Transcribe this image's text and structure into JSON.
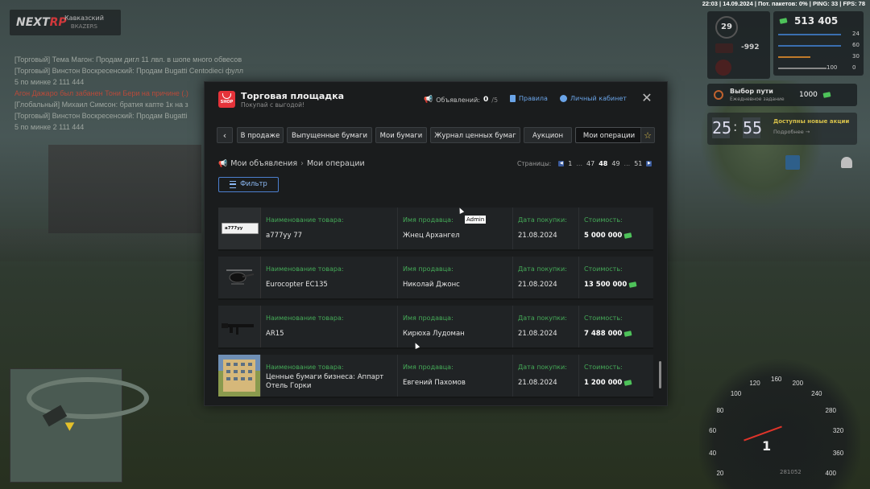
{
  "topbar": {
    "text": "22:03 | 14.09.2024 | Пот. пакетов: 0% | PING: 33 | FPS: 78"
  },
  "server": {
    "logo_a": "NEXT",
    "logo_b": "RP",
    "name": "Кавказский",
    "sub": "ВКАZERS"
  },
  "hud": {
    "money": "513 405",
    "level": "29",
    "balance": "-992",
    "stats": [
      "24",
      "60",
      "30",
      "100",
      "0"
    ],
    "quest_title": "Выбор пути",
    "quest_sub": "Ежедневное задание",
    "quest_reward": "1000",
    "time_h": "25",
    "time_m": "55",
    "available_actions": "Доступны новые акции",
    "details": "Подробнее →"
  },
  "chat": [
    {
      "text": "[Торговый] Тема Магон: Продам дигл 11 лвл. в шопе много обвесов",
      "cls": ""
    },
    {
      "text": "[Торговый] Винстон Воскресенский: Продам Bugatti Centodieci фулл",
      "cls": ""
    },
    {
      "text": "5 по минке 2 111 444",
      "cls": ""
    },
    {
      "text": "Агон Дажаро был забанен Тони Бери на причине (.)",
      "cls": "red"
    },
    {
      "text": "[Глобальный] Михаил Симсон: братия капте 1к на з",
      "cls": ""
    },
    {
      "text": "[Торговый] Винстон Воскресенский: Продам Bugatti",
      "cls": ""
    },
    {
      "text": "5 по минке 2 111 444",
      "cls": ""
    }
  ],
  "modal": {
    "title": "Торговая площадка",
    "subtitle": "Покупай с выгодой!",
    "shop_label": "SHOP",
    "ads_label": "Объявлений:",
    "ads_count": "0",
    "ads_max": "/5",
    "rules": "Правила",
    "cabinet": "Личный кабинет",
    "close": "✕"
  },
  "tabs": [
    {
      "label": "‹",
      "name": "tab-back"
    },
    {
      "label": "В продаже",
      "name": "tab-on-sale"
    },
    {
      "label": "Выпущенные бумаги",
      "name": "tab-issued-papers"
    },
    {
      "label": "Мои бумаги",
      "name": "tab-my-papers"
    },
    {
      "label": "Журнал ценных бумаг",
      "name": "tab-securities-journal"
    },
    {
      "label": "Аукцион",
      "name": "tab-auction"
    },
    {
      "label": "Мои операции",
      "name": "tab-my-operations"
    },
    {
      "label": "☆",
      "name": "tab-favorites"
    }
  ],
  "breadcrumb": {
    "parent": "Мои объявления",
    "current": "Мои операции"
  },
  "pagination": {
    "label": "Страницы:",
    "pages": [
      "1",
      "...",
      "47",
      "48",
      "49",
      "...",
      "51"
    ],
    "current": "48"
  },
  "filter_label": "Фильтр",
  "tooltip": "Admin",
  "columns": {
    "name": "Наименование товара:",
    "seller": "Имя продавца:",
    "date": "Дата покупки:",
    "price": "Стоимость:"
  },
  "operations": [
    {
      "item": "a777yy 77",
      "seller": "Жнец Архангел",
      "date": "21.08.2024",
      "price": "5 000 000",
      "thumb": "plate",
      "plate_text": "a777yy"
    },
    {
      "item": "Eurocopter EC135",
      "seller": "Николай Джонс",
      "date": "21.08.2024",
      "price": "13 500 000",
      "thumb": "heli"
    },
    {
      "item": "AR15",
      "seller": "Кирюха Лудоман",
      "date": "21.08.2024",
      "price": "7 488 000",
      "thumb": "rifle"
    },
    {
      "item": "Ценные бумаги бизнеса: Аппарт Отель Горки",
      "seller": "Евгений Пахомов",
      "date": "21.08.2024",
      "price": "1 200 000",
      "thumb": "building"
    }
  ],
  "speedometer": {
    "marks": [
      "20",
      "40",
      "60",
      "80",
      "100",
      "120",
      "160",
      "200",
      "240",
      "280",
      "320",
      "360",
      "400"
    ],
    "gear": "1",
    "odometer": "281052"
  }
}
